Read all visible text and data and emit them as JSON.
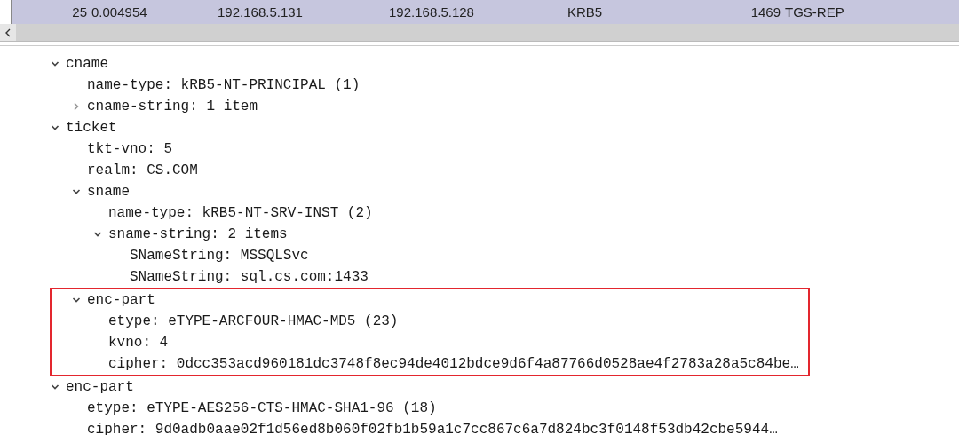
{
  "packet_row": {
    "selected": true,
    "columns": [
      "25",
      "0.004954",
      "192.168.5.131",
      "192.168.5.128",
      "KRB5",
      "1469",
      "TGS-REP"
    ]
  },
  "tree": [
    {
      "label": "cname",
      "expanded": true,
      "children": [
        {
          "label": "name-type: kRB5-NT-PRINCIPAL (1)"
        },
        {
          "label": "cname-string: 1 item",
          "expanded": false
        }
      ]
    },
    {
      "label": "ticket",
      "expanded": true,
      "children": [
        {
          "label": "tkt-vno: 5"
        },
        {
          "label": "realm: CS.COM"
        },
        {
          "label": "sname",
          "expanded": true,
          "children": [
            {
              "label": "name-type: kRB5-NT-SRV-INST (2)"
            },
            {
              "label": "sname-string: 2 items",
              "expanded": true,
              "children": [
                {
                  "label": "SNameString: MSSQLSvc"
                },
                {
                  "label": "SNameString: sql.cs.com:1433"
                }
              ]
            }
          ]
        },
        {
          "label": "enc-part",
          "expanded": true,
          "highlighted": true,
          "children": [
            {
              "label": "etype: eTYPE-ARCFOUR-HMAC-MD5 (23)"
            },
            {
              "label": "kvno: 4"
            },
            {
              "label": "cipher: 0dcc353acd960181dc3748f8ec94de4012bdce9d6f4a87766d0528ae4f2783a28a5c84be…"
            }
          ]
        }
      ]
    },
    {
      "label": "enc-part",
      "expanded": true,
      "children": [
        {
          "label": "etype: eTYPE-AES256-CTS-HMAC-SHA1-96 (18)"
        },
        {
          "label": "cipher: 9d0adb0aae02f1d56ed8b060f02fb1b59a1c7cc867c6a7d824bc3f0148f53db42cbe5944…"
        }
      ]
    }
  ]
}
